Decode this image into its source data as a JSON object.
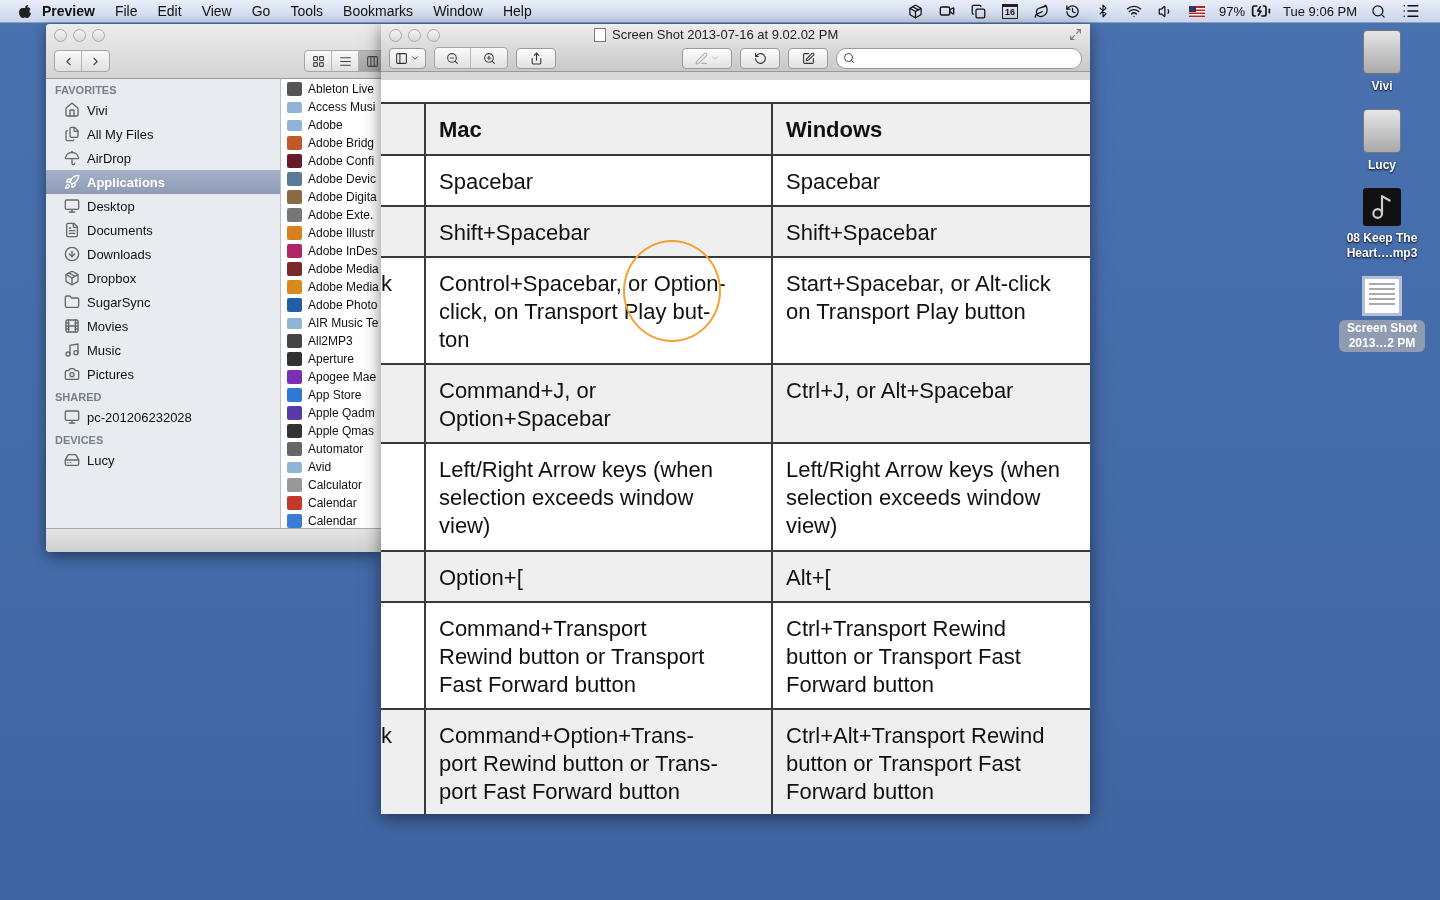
{
  "menu_bar": {
    "app": "Preview",
    "menus": [
      "File",
      "Edit",
      "View",
      "Go",
      "Tools",
      "Bookmarks",
      "Window",
      "Help"
    ],
    "calendar_day": "16",
    "battery": "97%",
    "clock": "Tue 9:06 PM"
  },
  "finder": {
    "view_buttons": [
      {
        "selected": false
      },
      {
        "selected": false
      },
      {
        "selected": true
      }
    ],
    "sidebar": [
      {
        "heading": "FAVORITES",
        "items": [
          {
            "label": "Vivi",
            "selected": false
          },
          {
            "label": "All My Files",
            "selected": false
          },
          {
            "label": "AirDrop",
            "selected": false
          },
          {
            "label": "Applications",
            "selected": true
          },
          {
            "label": "Desktop",
            "selected": false
          },
          {
            "label": "Documents",
            "selected": false
          },
          {
            "label": "Downloads",
            "selected": false
          },
          {
            "label": "Dropbox",
            "selected": false
          },
          {
            "label": "SugarSync",
            "selected": false
          },
          {
            "label": "Movies",
            "selected": false
          },
          {
            "label": "Music",
            "selected": false
          },
          {
            "label": "Pictures",
            "selected": false
          }
        ]
      },
      {
        "heading": "SHARED",
        "items": [
          {
            "label": "pc-201206232028",
            "selected": false
          }
        ]
      },
      {
        "heading": "DEVICES",
        "items": [
          {
            "label": "Lucy",
            "selected": false
          }
        ]
      }
    ],
    "files": [
      {
        "name": "Ableton Live",
        "kind": "app"
      },
      {
        "name": "Access Musi",
        "kind": "folder"
      },
      {
        "name": "Adobe",
        "kind": "folder"
      },
      {
        "name": "Adobe Bridg",
        "kind": "app"
      },
      {
        "name": "Adobe Confi",
        "kind": "app"
      },
      {
        "name": "Adobe Devic",
        "kind": "app"
      },
      {
        "name": "Adobe Digita",
        "kind": "app"
      },
      {
        "name": "Adobe Exte.",
        "kind": "app"
      },
      {
        "name": "Adobe Illustr",
        "kind": "app"
      },
      {
        "name": "Adobe InDes",
        "kind": "app"
      },
      {
        "name": "Adobe Media",
        "kind": "app"
      },
      {
        "name": "Adobe Media",
        "kind": "app"
      },
      {
        "name": "Adobe Photo",
        "kind": "app"
      },
      {
        "name": "AIR Music Te",
        "kind": "folder"
      },
      {
        "name": "All2MP3",
        "kind": "app"
      },
      {
        "name": "Aperture",
        "kind": "app"
      },
      {
        "name": "Apogee Mae",
        "kind": "app"
      },
      {
        "name": "App Store",
        "kind": "app"
      },
      {
        "name": "Apple Qadm",
        "kind": "app"
      },
      {
        "name": "Apple Qmas",
        "kind": "app"
      },
      {
        "name": "Automator",
        "kind": "app"
      },
      {
        "name": "Avid",
        "kind": "folder"
      },
      {
        "name": "Calculator",
        "kind": "app"
      },
      {
        "name": "Calendar",
        "kind": "app"
      },
      {
        "name": "Calendar",
        "kind": "app"
      }
    ]
  },
  "preview": {
    "title": "Screen Shot 2013-07-16 at 9.02.02 PM",
    "table": {
      "header": {
        "mac": "Mac",
        "windows": "Windows"
      },
      "rows": [
        {
          "shaded": false,
          "mac": "Spacebar",
          "windows": "Spacebar"
        },
        {
          "shaded": true,
          "mac": "Shift+Spacebar",
          "windows": "Shift+Spacebar"
        },
        {
          "shaded": false,
          "column_1": "k",
          "mac": "Control+Spacebar, or Option-\nclick, on Transport Play but-\nton",
          "windows": "Start+Spacebar, or Alt-click\non Transport Play button"
        },
        {
          "shaded": true,
          "mac": "Command+J, or\nOption+Spacebar",
          "windows": "Ctrl+J, or Alt+Spacebar"
        },
        {
          "shaded": false,
          "mac": "Left/Right Arrow keys (when\nselection exceeds window\nview)",
          "windows": "Left/Right Arrow keys (when\nselection exceeds window\nview)"
        },
        {
          "shaded": true,
          "mac": "Option+[",
          "windows": "Alt+["
        },
        {
          "shaded": false,
          "mac": "Command+Transport\nRewind button or Transport\nFast Forward button",
          "windows": "Ctrl+Transport Rewind\nbutton or Transport Fast\nForward button"
        },
        {
          "shaded": true,
          "column_1": "k",
          "mac": "Command+Option+Trans-\nport Rewind button or Trans-\nport Fast Forward button",
          "windows": "Ctrl+Alt+Transport Rewind\nbutton or Transport Fast\nForward button"
        }
      ]
    }
  },
  "desktop_icons": [
    {
      "label": "Vivi",
      "kind": "drive",
      "selected": false
    },
    {
      "label": "Lucy",
      "kind": "drive",
      "selected": false
    },
    {
      "label": "08 Keep The\nHeart….mp3",
      "kind": "music",
      "selected": false
    },
    {
      "label": "Screen Shot\n2013…2 PM",
      "kind": "document",
      "selected": true
    }
  ]
}
